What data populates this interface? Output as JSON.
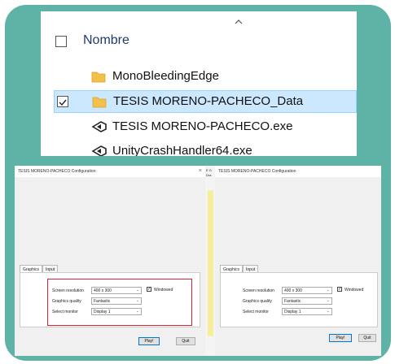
{
  "explorer": {
    "column_header": "Nombre",
    "items": [
      {
        "name": "MonoBleedingEdge",
        "type": "folder",
        "selected": false
      },
      {
        "name": "TESIS MORENO-PACHECO_Data",
        "type": "folder",
        "selected": true
      },
      {
        "name": "TESIS MORENO-PACHECO.exe",
        "type": "exe",
        "selected": false
      },
      {
        "name": "UnityCrashHandler64.exe",
        "type": "exe",
        "selected": false
      }
    ]
  },
  "config_left": {
    "title": "TESIS MORENO-PACHECO Configuration",
    "close": "×",
    "tabs": [
      "Graphics",
      "Input"
    ],
    "screen_resolution_label": "Screen resolution",
    "screen_resolution_value": "400 x 300",
    "windowed_label": "Windowed",
    "graphics_quality_label": "Graphics quality",
    "graphics_quality_value": "Fantastic",
    "select_monitor_label": "Select monitor",
    "select_monitor_value": "Display 1",
    "play_label": "Play!",
    "quit_label": "Quit"
  },
  "config_right": {
    "title": "TESIS MORENO-PACHECO Configuration",
    "close": "×",
    "tabs": [
      "Graphics",
      "Input"
    ],
    "screen_resolution_label": "Screen resolution",
    "screen_resolution_value": "400 x 300",
    "windowed_label": "Windowed",
    "graphics_quality_label": "Graphics quality",
    "graphics_quality_value": "Fantastic",
    "select_monitor_label": "Select monitor",
    "select_monitor_value": "Display 1",
    "play_label": "Play!",
    "quit_label": "Quit"
  },
  "middle_fragment": {
    "line1": "E G",
    "line2": "Dra"
  },
  "colors": {
    "card": "#5fb3a6",
    "highlight": "#d9232e",
    "selection": "#cce8ff"
  }
}
